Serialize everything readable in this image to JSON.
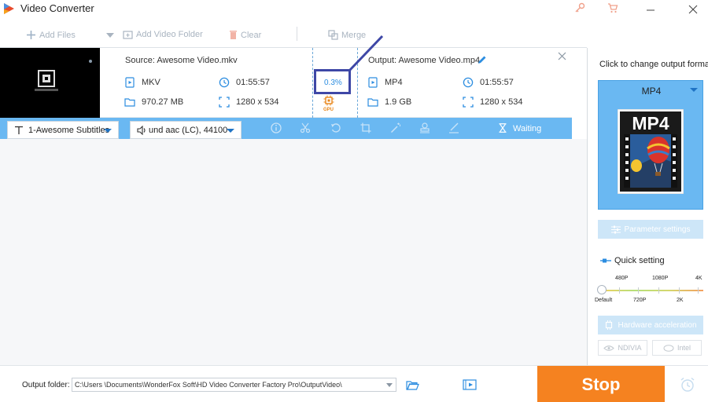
{
  "window": {
    "title": "Video Converter"
  },
  "toolbar": {
    "add_files": "Add Files",
    "add_video_folder": "Add Video Folder",
    "clear": "Clear",
    "merge": "Merge"
  },
  "task": {
    "source_title": "Source: Awesome Video.mkv",
    "source_format": "MKV",
    "source_duration": "01:55:57",
    "source_size": "970.27 MB",
    "source_resolution": "1280 x 534",
    "progress": "0.3%",
    "gpu_label": "GPU",
    "output_title": "Output: Awesome Video.mp4",
    "output_format": "MP4",
    "output_duration": "01:55:57",
    "output_size": "1.9 GB",
    "output_resolution": "1280 x 534",
    "subtitle_select": "1-Awesome Subtitles",
    "audio_select": "und aac (LC), 44100",
    "status": "Waiting"
  },
  "right_panel": {
    "title": "Click to change output format:",
    "format": "MP4",
    "format_badge": "MP4",
    "parameter_settings": "Parameter settings",
    "quick_setting": "Quick setting",
    "resolutions_top": [
      "480P",
      "1080P",
      "4K"
    ],
    "resolutions_bottom": [
      "Default",
      "720P",
      "2K"
    ],
    "quick_setting_value": 0,
    "hardware_acceleration": "Hardware acceleration",
    "nvidia": "NDIVIA",
    "intel": "Intel"
  },
  "bottom": {
    "output_folder_label": "Output folder:",
    "output_folder_path": "C:\\Users               \\Documents\\WonderFox Soft\\HD Video Converter Factory Pro\\OutputVideo\\",
    "stop": "Stop"
  },
  "colors": {
    "accent_blue": "#6ab8f2",
    "stop_orange": "#f58220",
    "annotation": "#3e47a6"
  }
}
